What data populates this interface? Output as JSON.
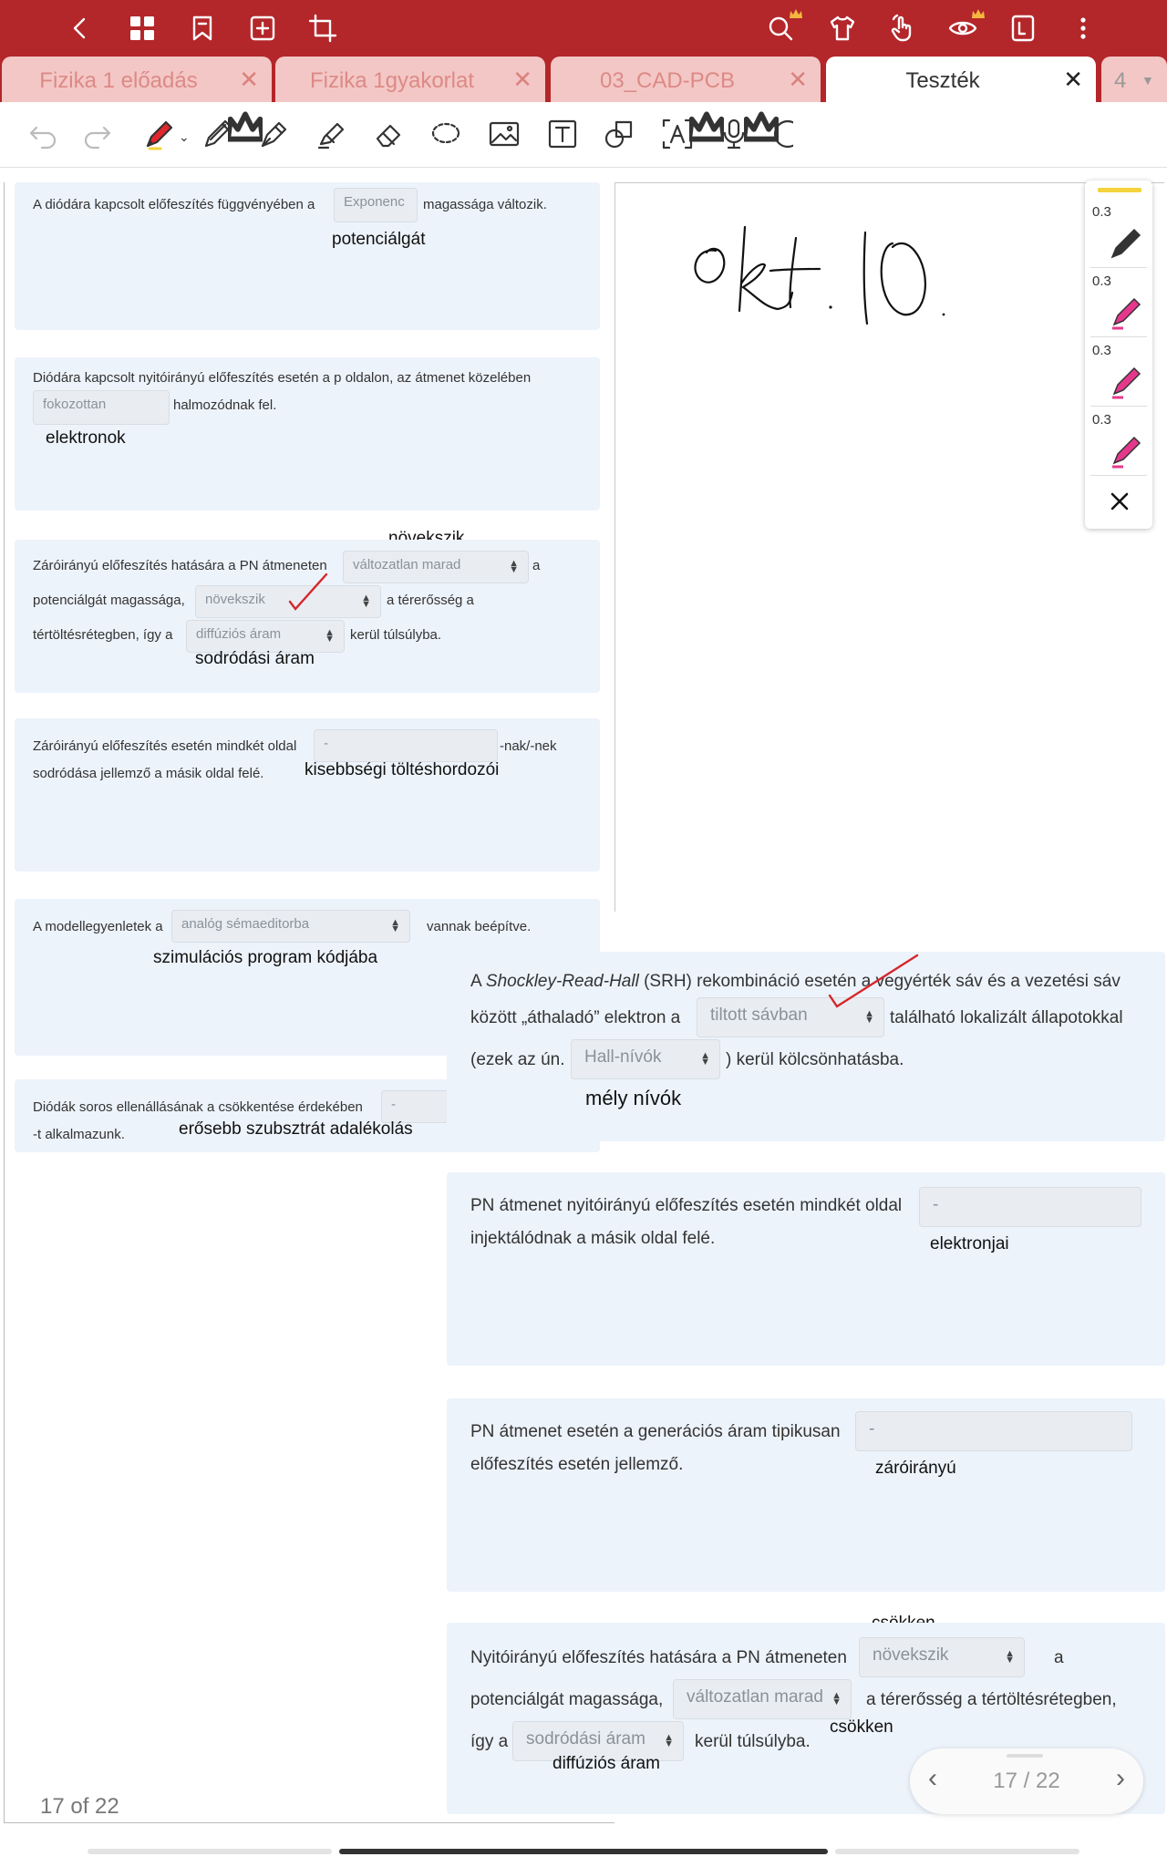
{
  "tabs": [
    {
      "label": "Fizika 1 előadás"
    },
    {
      "label": "Fizika 1gyakorlat"
    },
    {
      "label": "03_CAD-PCB"
    },
    {
      "label": "Teszték"
    },
    {
      "label": "4"
    }
  ],
  "tab_close": "✕",
  "colors": {
    "brand": "#b3262a",
    "card": "#edf3fb",
    "pen_pink": "#e5388c",
    "active_red": "#e0272d",
    "blue": "#2f4a8e"
  },
  "pen_sizes": [
    "0.3",
    "0.3",
    "0.3",
    "0.3"
  ],
  "handwriting_title": "okt. 10",
  "questions": [
    {
      "pre": "A diódára kapcsolt előfeszítés függvényében a",
      "input": "Exponenc",
      "post": "magassága változik.",
      "answer": "potenciálgát"
    },
    {
      "pre": "Diódára kapcsolt nyitóirányú előfeszítés esetén a p oldalon, az átmenet közelében",
      "input": "fokozottan",
      "post": "halmozódnak fel.",
      "answer": "elektronok"
    },
    {
      "pre": "Záróirányú előfeszítés hatására a PN átmeneten",
      "select1": "változatlan marad",
      "mid1": "a",
      "line2": "potenciálgát magassága,",
      "select2": "növekszik",
      "mid2": "a térerősség a",
      "line3": "tértöltésrétegben, így a",
      "select3": "diffúziós áram",
      "post": "kerül túlsúlyba.",
      "answer_top": "növekszik",
      "answer": "sodródási áram"
    },
    {
      "pre": "Záróirányú előfeszítés esetén mindkét oldal",
      "input": "-",
      "post": "-nak/-nek",
      "line2": "sodródása jellemző a másik oldal felé.",
      "answer": "kisebbségi töltéshordozói"
    },
    {
      "pre": "A modellegyenletek a",
      "select": "analóg sémaeditorba",
      "post": "vannak beépítve.",
      "answer": "szimulációs program kódjába"
    },
    {
      "pre": "Diódák soros ellenállásának a csökkentése érdekében",
      "input": "-",
      "line2": "-t alkalmazunk.",
      "answer": "erősebb szubsztrát adalékolás"
    }
  ],
  "questions_right": [
    {
      "pre_italic": "Shockley-Read-Hall",
      "pre1": "A",
      "pre2": "(SRH) rekombináció esetén a vegyérték sáv és a vezetési sáv",
      "line2": "között „áthaladó” elektron a",
      "select1": "tiltott sávban",
      "mid": "található lokalizált állapotokkal",
      "line3": "(ezek az ún.",
      "select2": "Hall-nívók",
      "post": ") kerül kölcsönhatásba.",
      "answer": "mély nívók"
    },
    {
      "pre": "PN átmenet nyitóirányú előfeszítés esetén mindkét oldal",
      "input": "-",
      "line2": "injektálódnak a másik oldal felé.",
      "answer": "elektronjai"
    },
    {
      "pre": "PN átmenet esetén a generációs áram tipikusan",
      "input": "-",
      "line2": "előfeszítés esetén jellemző.",
      "answer": "záróirányú"
    },
    {
      "pre": "Nyitóirányú előfeszítés hatására a PN átmeneten",
      "select1": "növekszik",
      "mid1": "a",
      "line2": "potenciálgát magassága,",
      "select2": "változatlan marad",
      "mid2": "a térerősség a tértöltésrétegben,",
      "line3": "így a",
      "select3": "sodródási áram",
      "post": "kerül túlsúlyba.",
      "answer_top": "csökken",
      "answer_mid": "csökken",
      "answer": "diffúziós áram"
    }
  ],
  "pager": {
    "current": "17 / 22",
    "label": "17 of 22"
  }
}
